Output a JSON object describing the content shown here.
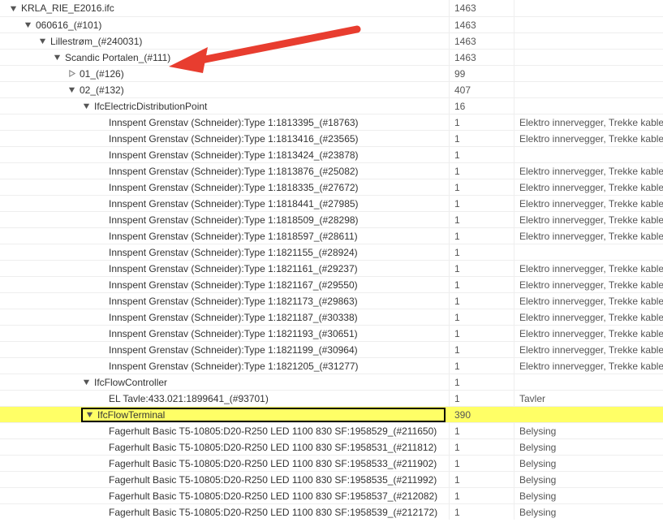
{
  "colors": {
    "highlight": "#ffff66",
    "arrow": "#e83d2f"
  },
  "desc_text": "Elektro innervegger, Trekke kabler, Kor",
  "tavler_text": "Tavler",
  "belysing_text": "Belysing",
  "rows": [
    {
      "indent": 0,
      "toggle": "open",
      "label": "KRLA_RIE_E2016.ifc",
      "count": "1463",
      "desc": "",
      "hl": false
    },
    {
      "indent": 1,
      "toggle": "open",
      "label": "060616_(#101)",
      "count": "1463",
      "desc": "",
      "hl": false
    },
    {
      "indent": 2,
      "toggle": "open",
      "label": "Lillestrøm_(#240031)",
      "count": "1463",
      "desc": "",
      "hl": false
    },
    {
      "indent": 3,
      "toggle": "open",
      "label": "Scandic Portalen_(#111)",
      "count": "1463",
      "desc": "",
      "hl": false
    },
    {
      "indent": 4,
      "toggle": "closed",
      "label": "01_(#126)",
      "count": "99",
      "desc": "",
      "hl": false
    },
    {
      "indent": 4,
      "toggle": "open",
      "label": "02_(#132)",
      "count": "407",
      "desc": "",
      "hl": false
    },
    {
      "indent": 5,
      "toggle": "open",
      "label": "IfcElectricDistributionPoint",
      "count": "16",
      "desc": "",
      "hl": false
    },
    {
      "indent": 6,
      "toggle": "none",
      "label": "Innspent Grenstav (Schneider):Type 1:1813395_(#18763)",
      "count": "1",
      "desc": "Elektro innervegger, Trekke kabler, Kor",
      "hl": false
    },
    {
      "indent": 6,
      "toggle": "none",
      "label": "Innspent Grenstav (Schneider):Type 1:1813416_(#23565)",
      "count": "1",
      "desc": "Elektro innervegger, Trekke kabler, Kor",
      "hl": false
    },
    {
      "indent": 6,
      "toggle": "none",
      "label": "Innspent Grenstav (Schneider):Type 1:1813424_(#23878)",
      "count": "1",
      "desc": "",
      "hl": false
    },
    {
      "indent": 6,
      "toggle": "none",
      "label": "Innspent Grenstav (Schneider):Type 1:1813876_(#25082)",
      "count": "1",
      "desc": "Elektro innervegger, Trekke kabler, Kor",
      "hl": false
    },
    {
      "indent": 6,
      "toggle": "none",
      "label": "Innspent Grenstav (Schneider):Type 1:1818335_(#27672)",
      "count": "1",
      "desc": "Elektro innervegger, Trekke kabler, Kor",
      "hl": false
    },
    {
      "indent": 6,
      "toggle": "none",
      "label": "Innspent Grenstav (Schneider):Type 1:1818441_(#27985)",
      "count": "1",
      "desc": "Elektro innervegger, Trekke kabler, Kor",
      "hl": false
    },
    {
      "indent": 6,
      "toggle": "none",
      "label": "Innspent Grenstav (Schneider):Type 1:1818509_(#28298)",
      "count": "1",
      "desc": "Elektro innervegger, Trekke kabler, Kor",
      "hl": false
    },
    {
      "indent": 6,
      "toggle": "none",
      "label": "Innspent Grenstav (Schneider):Type 1:1818597_(#28611)",
      "count": "1",
      "desc": "Elektro innervegger, Trekke kabler, Kor",
      "hl": false
    },
    {
      "indent": 6,
      "toggle": "none",
      "label": "Innspent Grenstav (Schneider):Type 1:1821155_(#28924)",
      "count": "1",
      "desc": "",
      "hl": false
    },
    {
      "indent": 6,
      "toggle": "none",
      "label": "Innspent Grenstav (Schneider):Type 1:1821161_(#29237)",
      "count": "1",
      "desc": "Elektro innervegger, Trekke kabler, Kor",
      "hl": false
    },
    {
      "indent": 6,
      "toggle": "none",
      "label": "Innspent Grenstav (Schneider):Type 1:1821167_(#29550)",
      "count": "1",
      "desc": "Elektro innervegger, Trekke kabler, Kor",
      "hl": false
    },
    {
      "indent": 6,
      "toggle": "none",
      "label": "Innspent Grenstav (Schneider):Type 1:1821173_(#29863)",
      "count": "1",
      "desc": "Elektro innervegger, Trekke kabler, Kor",
      "hl": false
    },
    {
      "indent": 6,
      "toggle": "none",
      "label": "Innspent Grenstav (Schneider):Type 1:1821187_(#30338)",
      "count": "1",
      "desc": "Elektro innervegger, Trekke kabler, Kor",
      "hl": false
    },
    {
      "indent": 6,
      "toggle": "none",
      "label": "Innspent Grenstav (Schneider):Type 1:1821193_(#30651)",
      "count": "1",
      "desc": "Elektro innervegger, Trekke kabler, Kor",
      "hl": false
    },
    {
      "indent": 6,
      "toggle": "none",
      "label": "Innspent Grenstav (Schneider):Type 1:1821199_(#30964)",
      "count": "1",
      "desc": "Elektro innervegger, Trekke kabler, Kor",
      "hl": false
    },
    {
      "indent": 6,
      "toggle": "none",
      "label": "Innspent Grenstav (Schneider):Type 1:1821205_(#31277)",
      "count": "1",
      "desc": "Elektro innervegger, Trekke kabler, Kor",
      "hl": false
    },
    {
      "indent": 5,
      "toggle": "open",
      "label": "IfcFlowController",
      "count": "1",
      "desc": "",
      "hl": false
    },
    {
      "indent": 6,
      "toggle": "none",
      "label": "EL Tavle:433.021:1899641_(#93701)",
      "count": "1",
      "desc": "Tavler",
      "hl": false
    },
    {
      "indent": 5,
      "toggle": "open",
      "label": "IfcFlowTerminal",
      "count": "390",
      "desc": "",
      "hl": true
    },
    {
      "indent": 6,
      "toggle": "none",
      "label": "Fagerhult Basic T5-10805:D20-R250 LED 1100 830 SF:1958529_(#211650)",
      "count": "1",
      "desc": "Belysing",
      "hl": false
    },
    {
      "indent": 6,
      "toggle": "none",
      "label": "Fagerhult Basic T5-10805:D20-R250 LED 1100 830 SF:1958531_(#211812)",
      "count": "1",
      "desc": "Belysing",
      "hl": false
    },
    {
      "indent": 6,
      "toggle": "none",
      "label": "Fagerhult Basic T5-10805:D20-R250 LED 1100 830 SF:1958533_(#211902)",
      "count": "1",
      "desc": "Belysing",
      "hl": false
    },
    {
      "indent": 6,
      "toggle": "none",
      "label": "Fagerhult Basic T5-10805:D20-R250 LED 1100 830 SF:1958535_(#211992)",
      "count": "1",
      "desc": "Belysing",
      "hl": false
    },
    {
      "indent": 6,
      "toggle": "none",
      "label": "Fagerhult Basic T5-10805:D20-R250 LED 1100 830 SF:1958537_(#212082)",
      "count": "1",
      "desc": "Belysing",
      "hl": false
    },
    {
      "indent": 6,
      "toggle": "none",
      "label": "Fagerhult Basic T5-10805:D20-R250 LED 1100 830 SF:1958539_(#212172)",
      "count": "1",
      "desc": "Belysing",
      "hl": false
    }
  ]
}
